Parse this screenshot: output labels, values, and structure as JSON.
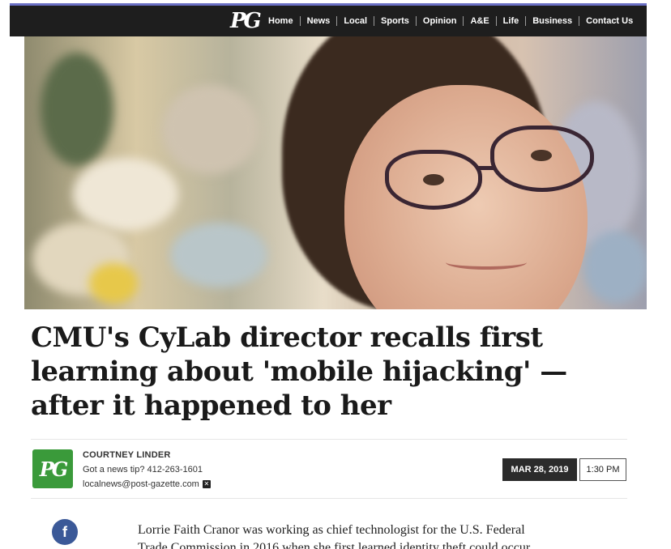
{
  "nav": {
    "logo_text": "PG",
    "items": [
      {
        "label": "Home"
      },
      {
        "label": "News"
      },
      {
        "label": "Local"
      },
      {
        "label": "Sports"
      },
      {
        "label": "Opinion"
      },
      {
        "label": "A&E"
      },
      {
        "label": "Life"
      },
      {
        "label": "Business"
      },
      {
        "label": "Contact Us"
      }
    ],
    "accent_color": "#6a6fc4",
    "bar_color": "#1e1e1e"
  },
  "article": {
    "headline": "CMU's CyLab director recalls first learning about 'mobile hijacking' — after it happened to her",
    "author": {
      "logo_text": "PG",
      "name": "COURTNEY LINDER",
      "tip": "Got a news tip? 412-263-1601",
      "email": "localnews@post-gazette.com",
      "email_icon": "x-icon",
      "logo_color": "#3a9a3a"
    },
    "date": "MAR 28, 2019",
    "time": "1:30 PM",
    "share": {
      "facebook_icon": "facebook-icon",
      "facebook_glyph": "f"
    },
    "body_first_line": "Lorrie Faith Cranor was working as chief technologist for the U.S. Federal",
    "body_second_line": "Trade Commission in 2016 when she first learned identity theft could occur"
  }
}
